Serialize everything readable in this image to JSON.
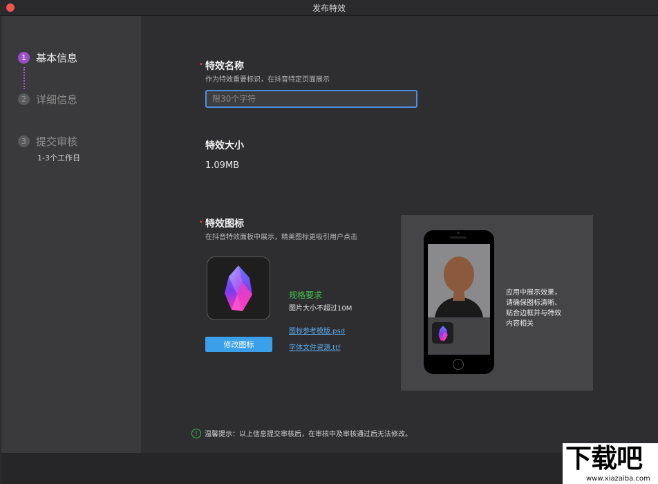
{
  "window": {
    "title": "发布特效"
  },
  "steps": [
    {
      "num": "1",
      "label": "基本信息"
    },
    {
      "num": "2",
      "label": "详细信息"
    },
    {
      "num": "3",
      "label": "提交审核",
      "sub": "1-3个工作日"
    }
  ],
  "name_section": {
    "required_mark": "•",
    "title": "特效名称",
    "subtitle": "作为特效重要标识，在抖音特定页面展示",
    "input_placeholder": "限30个字符",
    "input_value": ""
  },
  "size_section": {
    "title": "特效大小",
    "value": "1.09MB"
  },
  "icon_section": {
    "required_mark": "•",
    "title": "特效图标",
    "subtitle": "在抖音特效面板中展示，精美图标更吸引用户点击",
    "edit_button": "修改图标",
    "spec_title": "规格要求",
    "spec_text": "图片大小不超过10M",
    "links": [
      "图标参考模版.psd",
      "字体文件资源.ttf"
    ]
  },
  "preview": {
    "lines": [
      "应用中展示效果，",
      "请确保图标清晰、",
      "贴合边框并与特效",
      "内容相关"
    ]
  },
  "tip": {
    "icon": "!",
    "text": "温馨提示：以上信息提交审核后，在审核中及审核通过后无法修改。"
  },
  "watermark": {
    "main": "下载吧",
    "url": "www.xiazaiba.com"
  },
  "colors": {
    "accent": "#9b4fc7",
    "button": "#3aa0ea",
    "required": "#e04e4e",
    "spec": "#44c04b",
    "link": "#5aa8e8",
    "input_border": "#4a90e2"
  },
  "icons": {
    "close": "close-dot",
    "crystal": "crystal-gem-icon",
    "tip": "exclamation-circle-icon"
  }
}
